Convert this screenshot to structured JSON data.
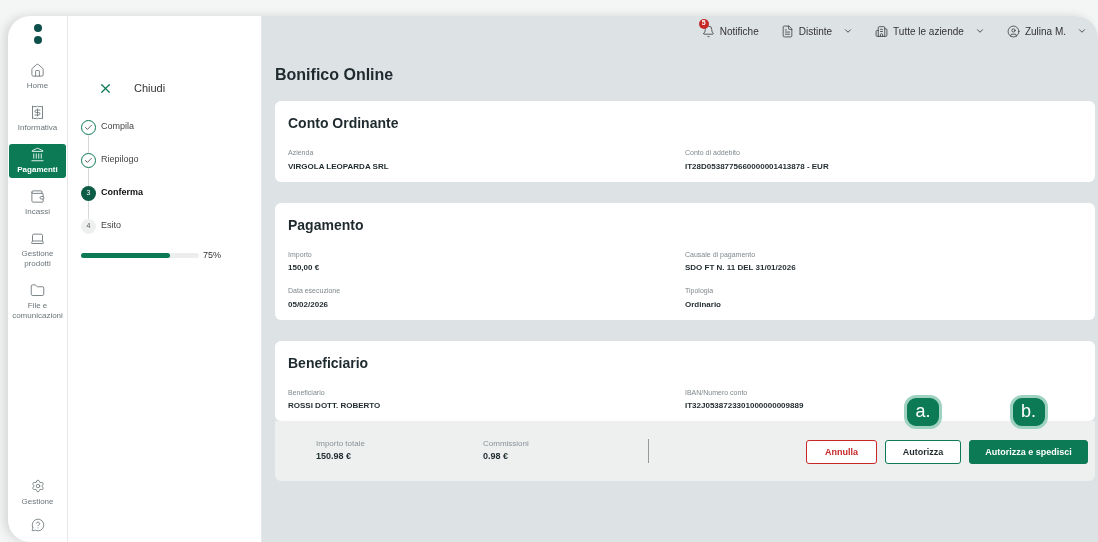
{
  "nav": {
    "items": [
      {
        "label": "Home",
        "selected": false
      },
      {
        "label": "Informativa",
        "selected": false
      },
      {
        "label": "Pagamenti",
        "selected": true
      },
      {
        "label": "Incassi",
        "selected": false
      },
      {
        "label": "Gestione prodotti",
        "selected": false
      },
      {
        "label": "File e comunicazioni",
        "selected": false
      }
    ],
    "bottom": [
      {
        "label": "Gestione"
      }
    ]
  },
  "stepper": {
    "close": "Chiudi",
    "steps": [
      {
        "label": "Compila",
        "done": true,
        "current": false
      },
      {
        "label": "Riepilogo",
        "done": true,
        "current": false
      },
      {
        "number": "3",
        "label": "Conferma",
        "done": false,
        "current": true
      },
      {
        "number": "4",
        "label": "Esito",
        "done": false,
        "current": false
      }
    ],
    "progress": {
      "level": 0.75,
      "reading": "75%"
    }
  },
  "topbar": [
    {
      "label": "Notifiche",
      "badge": "5",
      "dropdown": false
    },
    {
      "label": "Distinte",
      "dropdown": true
    },
    {
      "label": "Tutte le aziende",
      "dropdown": true
    },
    {
      "label": "Zulina M.",
      "dropdown": true
    }
  ],
  "title": "Bonifico Online",
  "cards": [
    {
      "title": "Conto Ordinante",
      "rows": [
        [
          {
            "label": "Azienda",
            "value": "VIRGOLA LEOPARDA SRL"
          },
          {
            "label": "Conto di addebito",
            "value": "IT28D0538775660000001413878 - EUR"
          }
        ]
      ]
    },
    {
      "title": "Pagamento",
      "rows": [
        [
          {
            "label": "Importo",
            "value": "150,00 €"
          },
          {
            "label": "Causale di pagamento",
            "value": "SDO FT N. 11 DEL 31/01/2026"
          }
        ],
        [
          {
            "label": "Data esecuzione",
            "value": "05/02/2026"
          },
          {
            "label": "Tipologia",
            "value": "Ordinario"
          }
        ]
      ]
    },
    {
      "title": "Beneficiario",
      "rows": [
        [
          {
            "label": "Beneficiario",
            "value": "ROSSI DOTT. ROBERTO"
          },
          {
            "label": "IBAN/Numero conto",
            "value": "IT32J0538723301000000009889"
          }
        ]
      ]
    }
  ],
  "footer": {
    "totals": [
      {
        "label": "Importo totale",
        "value": "150.98 €"
      },
      {
        "label": "Commissioni",
        "value": "0.98 €"
      }
    ],
    "buttons": [
      {
        "label": "Annulla",
        "kind": "danger"
      },
      {
        "label": "Autorizza",
        "kind": "outline",
        "callout": "a."
      },
      {
        "label": "Autorizza e spedisci",
        "kind": "primary",
        "callout": "b."
      }
    ]
  }
}
